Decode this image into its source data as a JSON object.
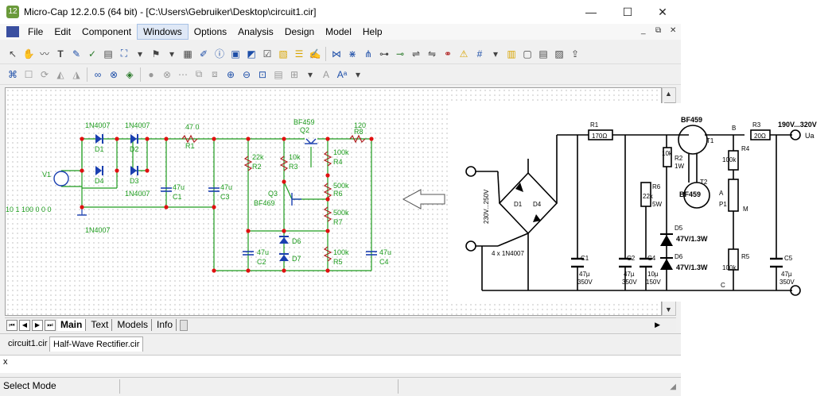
{
  "window": {
    "title": "Micro-Cap 12.2.0.5 (64 bit) - [C:\\Users\\Gebruiker\\Desktop\\circuit1.cir]",
    "app_icon_glyph": "12",
    "min_glyph": "—",
    "max_glyph": "☐",
    "close_glyph": "✕"
  },
  "menu": {
    "items": [
      "File",
      "Edit",
      "Component",
      "Windows",
      "Options",
      "Analysis",
      "Design",
      "Model",
      "Help"
    ],
    "active": "Windows",
    "mdi_controls": [
      "_",
      "⧉",
      "✕"
    ]
  },
  "toolbar_icons": {
    "row1": [
      "pointer-icon",
      "hand-icon",
      "wire-icon",
      "text-icon",
      "pen-icon",
      "probe-icon",
      "printer-icon",
      "component-icon",
      "dropdown-icon",
      "flag-icon",
      "dropdown-icon",
      "grid-icon",
      "brush-icon",
      "info-icon",
      "window-icon",
      "palette-icon",
      "checkbox-icon",
      "image-icon",
      "table-icon",
      "edit-icon",
      "pin-icon",
      "pin2-icon",
      "pin3-icon",
      "pin4-icon",
      "node-icon",
      "node2-icon",
      "node3-icon",
      "node4-icon",
      "warning-icon",
      "grid2-icon",
      "dropdown-icon",
      "page-icon",
      "page2-icon",
      "page3-icon",
      "page4-icon",
      "export-icon"
    ],
    "row2": [
      "tree-icon",
      "box-icon",
      "rotate-icon",
      "mirror-icon",
      "mirror2-icon",
      "binoculars-icon",
      "binoculars2-icon",
      "find-icon",
      "stop-icon",
      "cancel-icon",
      "dots-icon",
      "copy-icon",
      "copy2-icon",
      "zoom-in-icon",
      "zoom-out-icon",
      "zoom-fit-icon",
      "page5-icon",
      "align-icon",
      "dropdown-icon",
      "font-icon",
      "font-size-icon",
      "dropdown-icon"
    ]
  },
  "sheet_tabs": {
    "tabs": [
      "Main",
      "Text",
      "Models",
      "Info"
    ],
    "active": "Main"
  },
  "doc_tabs": {
    "tabs": [
      "circuit1.cir",
      "Half-Wave Rectifier.cir"
    ],
    "active": "Half-Wave Rectifier.cir"
  },
  "command": {
    "prefix": "x",
    "value": ""
  },
  "status": {
    "text": "Select Mode"
  },
  "schematic": {
    "source_label": "V1",
    "source_spec": "10 1 100 0 0 0",
    "d1": "1N4007",
    "d1_ref": "D1",
    "d2": "1N4007",
    "d2_ref": "D2",
    "d3": "1N4007",
    "d3_ref": "D3",
    "d4": "1N4007",
    "d4_ref": "D4",
    "d_bottom": "1N4007",
    "r1_value": "47 0",
    "r1_ref": "R1",
    "c1_value": "47u",
    "c1_ref": "C1",
    "c3_value": "47u",
    "c3_ref": "C3",
    "r2_value": "22k",
    "r2_ref": "R2",
    "r3_value": "10k",
    "r3_ref": "R3",
    "q2_model": "BF459",
    "q2_ref": "Q2",
    "q3_model": "BF469",
    "q3_ref": "Q3",
    "r8_value": "120",
    "r8_ref": "R8",
    "r4_value": "100k",
    "r4_ref": "R4",
    "r6_value": "500k",
    "r6_ref": "R6",
    "r7_value": "500k",
    "r7_ref": "R7",
    "r5_value": "100k",
    "r5_ref": "R5",
    "c2_value": "47u",
    "c2_ref": "C2",
    "c4_value": "47u",
    "c4_ref": "C4",
    "d6_ref": "D6",
    "d7_ref": "D7"
  },
  "reference": {
    "bridge_label": "4 x 1N4007",
    "ac_label": "230V...250V",
    "d_label1": "D1",
    "d_label2": "D4",
    "r1_ref": "R1",
    "r1_value": "170Ω",
    "t1_model": "BF459",
    "t1_ref": "T1",
    "r2_ref": "R2",
    "r2_value": "10k",
    "r2_power": "1W",
    "t2_ref": "T2",
    "t2_model": "BF459",
    "r6_ref": "R6",
    "r6_value": "22k",
    "r6_power": "5W",
    "d5_ref": "D5",
    "d5_value": "47V/1.3W",
    "d6_ref": "D6",
    "d6_value": "47V/1.3W",
    "c1_ref": "C1",
    "c1_value": "47µ",
    "c1_voltage": "350V",
    "c2_ref": "C2",
    "c2_value": "47µ",
    "c2_voltage": "350V",
    "c4_ref": "C4",
    "c4_value": "10µ",
    "c4_voltage": "150V",
    "r3_ref": "R3",
    "r3_value": "20Ω",
    "r4_ref": "R4",
    "r4_value": "100k",
    "p1_ref": "P1",
    "r5_ref": "R5",
    "r5_value": "100k",
    "c5_ref": "C5",
    "c5_value": "47µ",
    "c5_voltage": "350V",
    "node_b": "B",
    "node_a": "A",
    "node_m": "M",
    "node_c": "C",
    "out_label": "190V...320V",
    "out_name": "Ua"
  }
}
